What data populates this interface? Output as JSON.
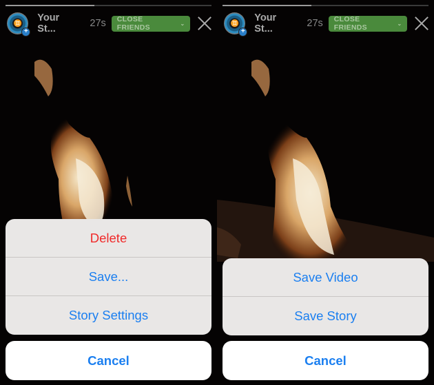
{
  "colors": {
    "accent": "#1b7ff0",
    "destructive": "#f02a2a",
    "badge_green": "#4a8a3c"
  },
  "panels": [
    {
      "header": {
        "progress_percent": 43,
        "avatar_icon": "gemini-sign-avatar",
        "username": "Your St...",
        "time": "27s",
        "badge_label": "CLOSE FRIENDS",
        "badge_icon": "chevron-down-icon",
        "close_icon": "close-icon"
      },
      "sheet": [
        {
          "label": "Delete",
          "destructive": true
        },
        {
          "label": "Save..."
        },
        {
          "label": "Story Settings"
        }
      ],
      "cancel_label": "Cancel"
    },
    {
      "header": {
        "progress_percent": 43,
        "avatar_icon": "gemini-sign-avatar",
        "username": "Your St...",
        "time": "27s",
        "badge_label": "CLOSE FRIENDS",
        "badge_icon": "chevron-down-icon",
        "close_icon": "close-icon"
      },
      "sheet": [
        {
          "label": "Save Video"
        },
        {
          "label": "Save Story"
        }
      ],
      "cancel_label": "Cancel"
    }
  ]
}
